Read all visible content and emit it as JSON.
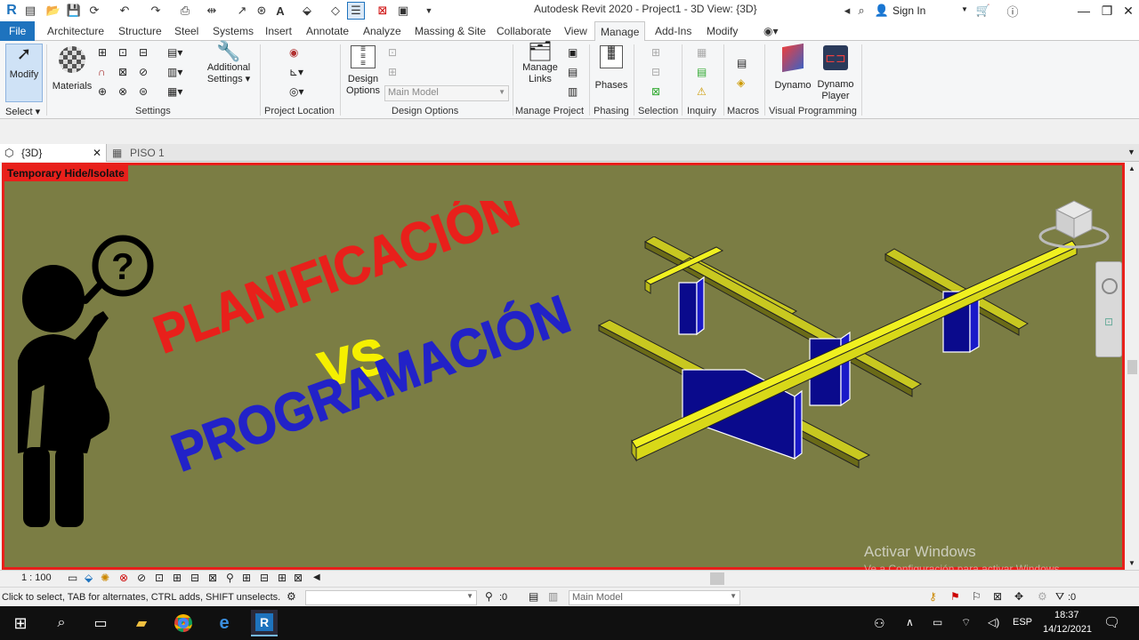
{
  "window": {
    "title": "Autodesk Revit 2020 - Project1 - 3D View: {3D}",
    "sign_in": "Sign In"
  },
  "tabs": [
    {
      "label": "File"
    },
    {
      "label": "Architecture"
    },
    {
      "label": "Structure"
    },
    {
      "label": "Steel"
    },
    {
      "label": "Systems"
    },
    {
      "label": "Insert"
    },
    {
      "label": "Annotate"
    },
    {
      "label": "Analyze"
    },
    {
      "label": "Massing & Site"
    },
    {
      "label": "Collaborate"
    },
    {
      "label": "View"
    },
    {
      "label": "Manage"
    },
    {
      "label": "Add-Ins"
    },
    {
      "label": "Modify"
    }
  ],
  "active_tab": "Manage",
  "ribbon": {
    "modify": "Modify",
    "select": "Select",
    "materials": "Materials",
    "additional_settings_1": "Additional",
    "additional_settings_2": "Settings",
    "settings_panel": "Settings",
    "project_location_panel": "Project Location",
    "design_options_1": "Design",
    "design_options_2": "Options",
    "main_model_value": "Main Model",
    "design_options_panel": "Design Options",
    "manage_links_1": "Manage",
    "manage_links_2": "Links",
    "manage_project_panel": "Manage Project",
    "phases": "Phases",
    "phasing_panel": "Phasing",
    "selection_panel": "Selection",
    "inquiry_panel": "Inquiry",
    "macros_panel": "Macros",
    "dynamo": "Dynamo",
    "dynamo_player_1": "Dynamo",
    "dynamo_player_2": "Player",
    "visual_programming_panel": "Visual Programming"
  },
  "view_tabs": [
    {
      "label": "{3D}"
    },
    {
      "label": "PISO 1"
    }
  ],
  "viewport": {
    "temp_hide_label": "Temporary Hide/Isolate",
    "text_top": "PLANIFICACIÓN",
    "text_mid": "VS",
    "text_bottom": "PROGRAMACIÓN",
    "colors": {
      "border": "#e8201b",
      "background": "#7b7d44",
      "red_text": "#e8201b",
      "yellow_text": "#f5f000",
      "blue_text": "#2222c8",
      "beam_yellow": "#f0f020",
      "column_blue": "#0a0a8c"
    }
  },
  "viewbar": {
    "scale": "1 : 100"
  },
  "status": {
    "hint": "Click to select, TAB for alternates, CTRL adds, SHIFT unselects.",
    "coord": ":0",
    "model": "Main Model",
    "filter_count": ":0"
  },
  "watermark": {
    "line1": "Activar Windows",
    "line2": "Ve a Configuración para activar Windows."
  },
  "taskbar": {
    "lang": "ESP",
    "time": "18:37",
    "date": "14/12/2021"
  }
}
